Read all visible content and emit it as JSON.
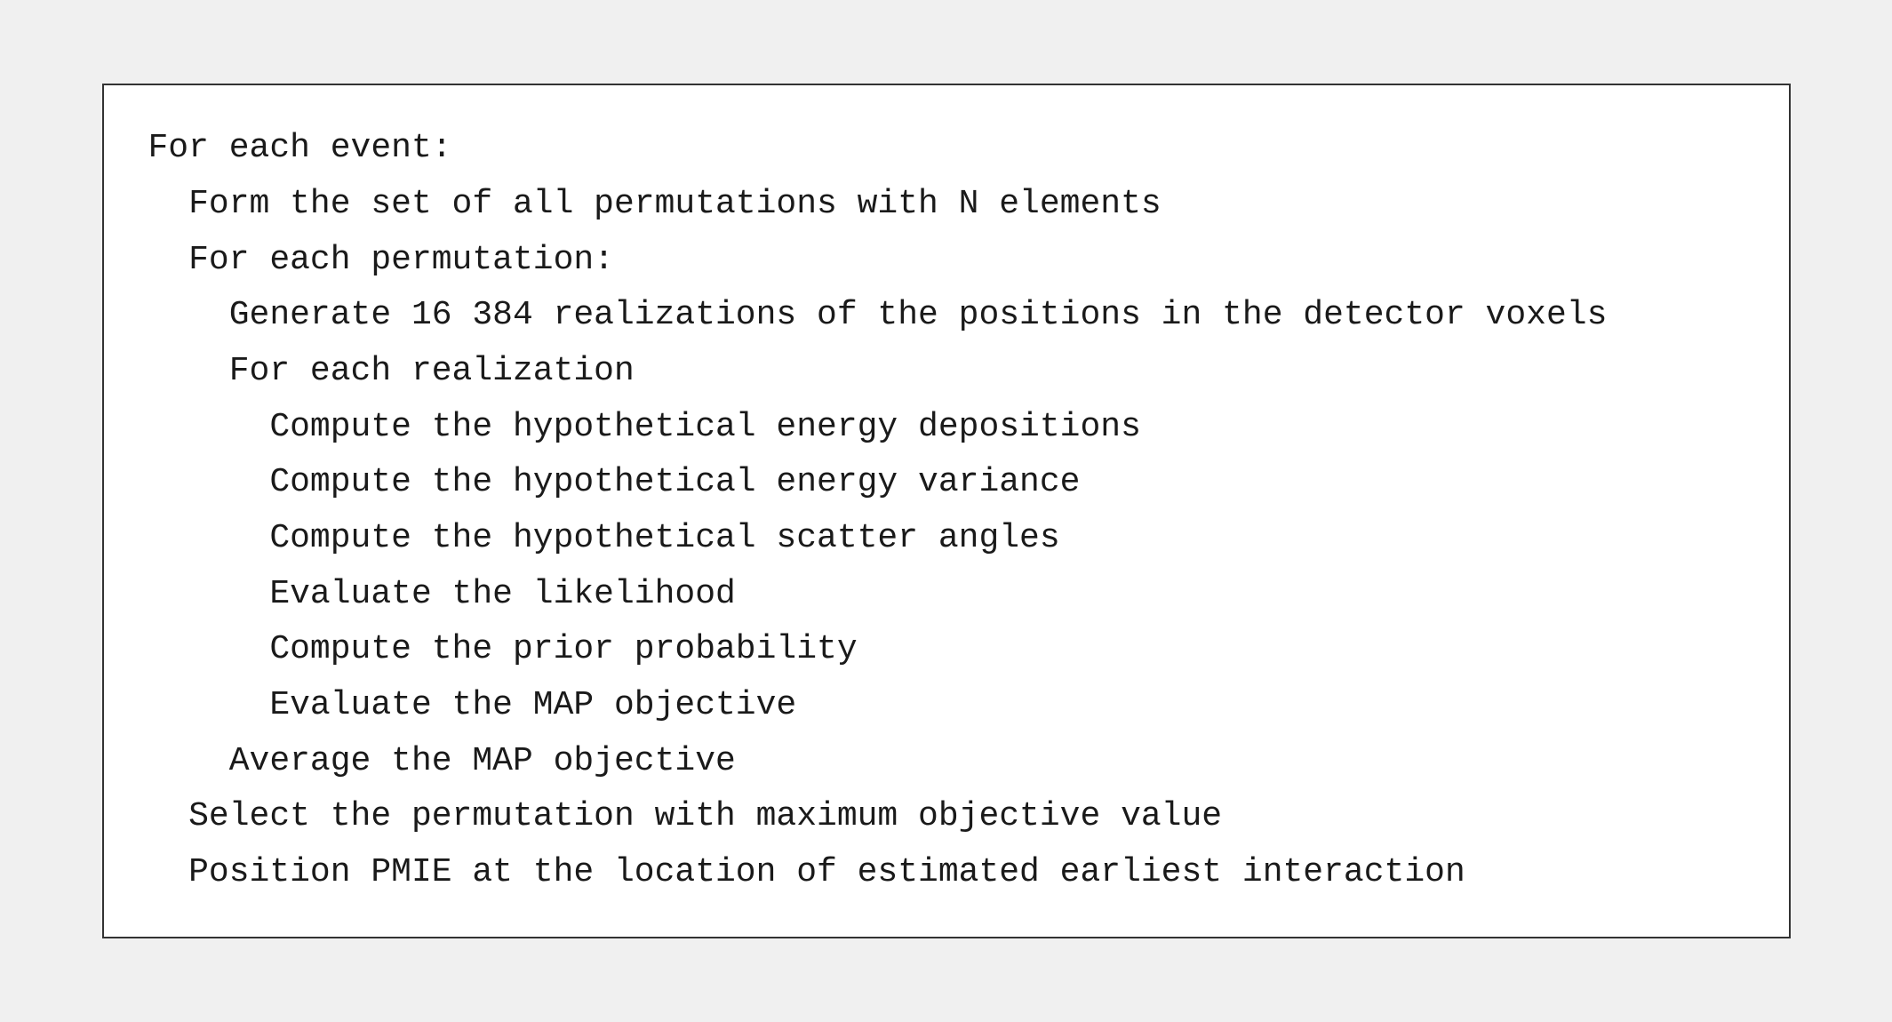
{
  "algorithm": {
    "lines": [
      {
        "id": "line-1",
        "indent": 0,
        "text": "For each event:"
      },
      {
        "id": "line-2",
        "indent": 1,
        "text": "  Form the set of all permutations with N elements"
      },
      {
        "id": "line-3",
        "indent": 1,
        "text": "  For each permutation:"
      },
      {
        "id": "line-4",
        "indent": 2,
        "text": "    Generate 16 384 realizations of the positions in the detector voxels"
      },
      {
        "id": "line-5",
        "indent": 2,
        "text": "    For each realization"
      },
      {
        "id": "line-6",
        "indent": 3,
        "text": "      Compute the hypothetical energy depositions"
      },
      {
        "id": "line-7",
        "indent": 3,
        "text": "      Compute the hypothetical energy variance"
      },
      {
        "id": "line-8",
        "indent": 3,
        "text": "      Compute the hypothetical scatter angles"
      },
      {
        "id": "line-9",
        "indent": 3,
        "text": "      Evaluate the likelihood"
      },
      {
        "id": "line-10",
        "indent": 3,
        "text": "      Compute the prior probability"
      },
      {
        "id": "line-11",
        "indent": 3,
        "text": "      Evaluate the MAP objective"
      },
      {
        "id": "line-12",
        "indent": 2,
        "text": "    Average the MAP objective"
      },
      {
        "id": "line-13",
        "indent": 1,
        "text": "  Select the permutation with maximum objective value"
      },
      {
        "id": "line-14",
        "indent": 1,
        "text": "  Position PMIE at the location of estimated earliest interaction"
      }
    ]
  }
}
